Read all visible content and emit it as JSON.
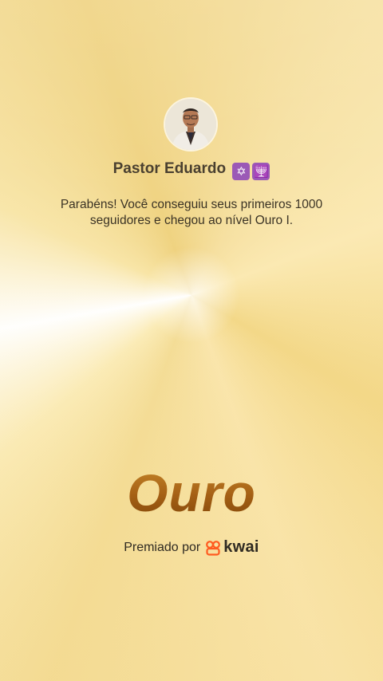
{
  "profile": {
    "username": "Pastor Eduardo",
    "badge_emojis": [
      "✡",
      "🕎"
    ]
  },
  "message": {
    "text": "Parabéns! Você conseguiu seus primeiros 1000 seguidores e chegou ao nível Ouro I."
  },
  "level": {
    "title": "Ouro"
  },
  "footer": {
    "awarded_by": "Premiado por",
    "brand": "kwai"
  },
  "colors": {
    "gold_text": "#a45f14",
    "brand_orange": "#ff5a1f",
    "background": "#f4dd97"
  }
}
